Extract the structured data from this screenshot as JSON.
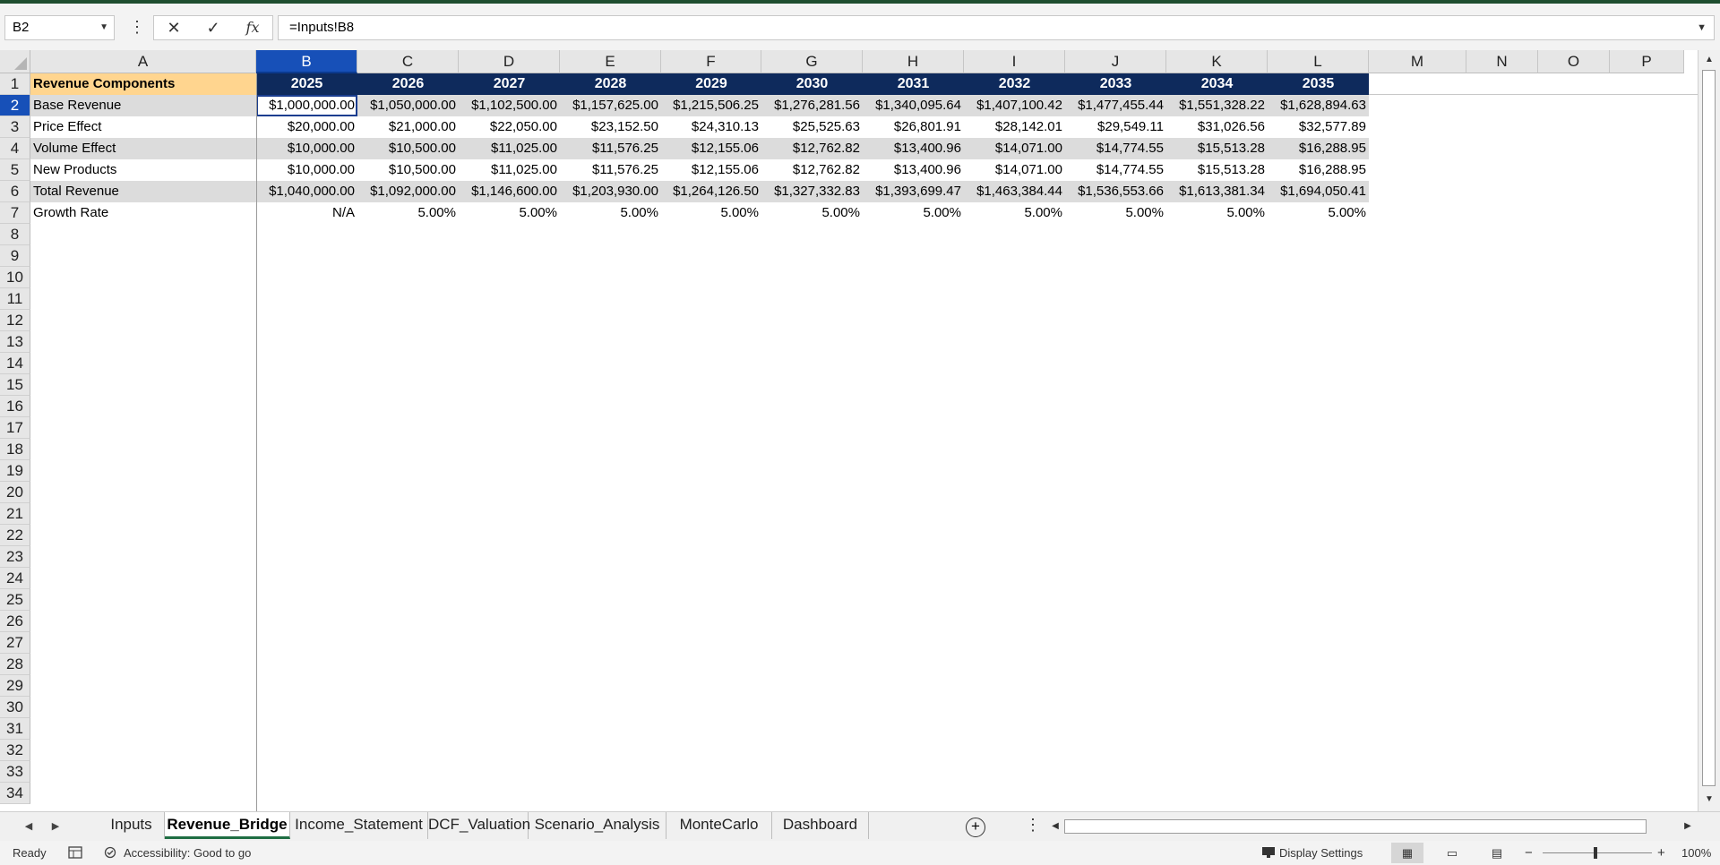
{
  "formula_bar": {
    "name_box": "B2",
    "formula": "=Inputs!B8",
    "cancel_icon": "x-icon",
    "enter_icon": "check-icon",
    "fx_label": "fx"
  },
  "columns": [
    "A",
    "B",
    "C",
    "D",
    "E",
    "F",
    "G",
    "H",
    "I",
    "J",
    "K",
    "L",
    "M",
    "N",
    "O",
    "P"
  ],
  "rows": [
    "1",
    "2",
    "3",
    "4",
    "5",
    "6",
    "7",
    "8",
    "9",
    "10",
    "11",
    "12",
    "13",
    "14",
    "15",
    "16",
    "17",
    "18",
    "19",
    "20",
    "21",
    "22",
    "23",
    "24",
    "25",
    "26",
    "27",
    "28",
    "29",
    "30",
    "31",
    "32",
    "33",
    "34"
  ],
  "sheet": {
    "header_label": "Revenue Components",
    "years": [
      "2025",
      "2026",
      "2027",
      "2028",
      "2029",
      "2030",
      "2031",
      "2032",
      "2033",
      "2034",
      "2035"
    ],
    "data_rows": [
      {
        "label": "Base Revenue",
        "values": [
          "$1,000,000.00",
          "$1,050,000.00",
          "$1,102,500.00",
          "$1,157,625.00",
          "$1,215,506.25",
          "$1,276,281.56",
          "$1,340,095.64",
          "$1,407,100.42",
          "$1,477,455.44",
          "$1,551,328.22",
          "$1,628,894.63"
        ]
      },
      {
        "label": "Price Effect",
        "values": [
          "$20,000.00",
          "$21,000.00",
          "$22,050.00",
          "$23,152.50",
          "$24,310.13",
          "$25,525.63",
          "$26,801.91",
          "$28,142.01",
          "$29,549.11",
          "$31,026.56",
          "$32,577.89"
        ]
      },
      {
        "label": "Volume Effect",
        "values": [
          "$10,000.00",
          "$10,500.00",
          "$11,025.00",
          "$11,576.25",
          "$12,155.06",
          "$12,762.82",
          "$13,400.96",
          "$14,071.00",
          "$14,774.55",
          "$15,513.28",
          "$16,288.95"
        ]
      },
      {
        "label": "New Products",
        "values": [
          "$10,000.00",
          "$10,500.00",
          "$11,025.00",
          "$11,576.25",
          "$12,155.06",
          "$12,762.82",
          "$13,400.96",
          "$14,071.00",
          "$14,774.55",
          "$15,513.28",
          "$16,288.95"
        ]
      },
      {
        "label": "Total Revenue",
        "values": [
          "$1,040,000.00",
          "$1,092,000.00",
          "$1,146,600.00",
          "$1,203,930.00",
          "$1,264,126.50",
          "$1,327,332.83",
          "$1,393,699.47",
          "$1,463,384.44",
          "$1,536,553.66",
          "$1,613,381.34",
          "$1,694,050.41"
        ]
      },
      {
        "label": "Growth Rate",
        "values": [
          "N/A",
          "5.00%",
          "5.00%",
          "5.00%",
          "5.00%",
          "5.00%",
          "5.00%",
          "5.00%",
          "5.00%",
          "5.00%",
          "5.00%"
        ]
      }
    ]
  },
  "tabs": [
    "Inputs",
    "Revenue_Bridge",
    "Income_Statement",
    "DCF_Valuation",
    "Scenario_Analysis",
    "MonteCarlo",
    "Dashboard"
  ],
  "active_tab": "Revenue_Bridge",
  "status": {
    "ready": "Ready",
    "accessibility": "Accessibility: Good to go",
    "display_settings": "Display Settings",
    "zoom": "100%"
  },
  "colors": {
    "header_year_bg": "#0e2a5c",
    "header_label_bg": "#ffd58f",
    "band_bg": "#dcdcdc",
    "selection": "#1750b8",
    "title_bar": "#1e4e2f"
  }
}
